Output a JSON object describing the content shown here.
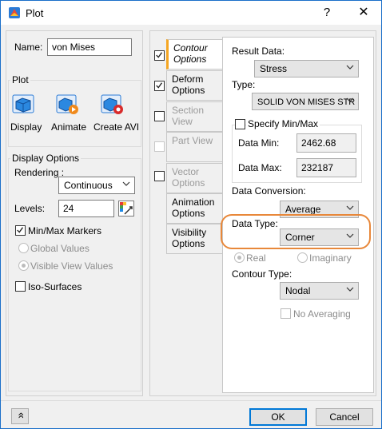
{
  "window": {
    "title": "Plot",
    "help_glyph": "?",
    "close_glyph": "✕"
  },
  "left": {
    "name_label": "Name:",
    "name_value": "von Mises",
    "plot_group": "Plot",
    "plot_buttons": [
      {
        "label": "Display",
        "icon": "display-icon"
      },
      {
        "label": "Animate",
        "icon": "animate-icon"
      },
      {
        "label": "Create AVI",
        "icon": "create-avi-icon"
      }
    ],
    "display_options": {
      "group": "Display Options",
      "rendering_label": "Rendering :",
      "rendering_value": "Continuous",
      "levels_label": "Levels:",
      "levels_value": "24",
      "minmax_label": "Min/Max Markers",
      "global_values": "Global Values",
      "visible_values": "Visible View Values",
      "iso_surfaces": "Iso-Surfaces"
    }
  },
  "tabs": [
    {
      "label_1": "Contour",
      "label_2": "Options",
      "checked": true
    },
    {
      "label_1": "Deform",
      "label_2": "Options",
      "checked": true
    },
    {
      "label_1": "Section View",
      "label_2": "",
      "checked": false
    },
    {
      "label_1": "Part View",
      "label_2": "",
      "checked": false
    },
    {
      "label_1": "Vector",
      "label_2": "Options",
      "checked": false
    },
    {
      "label_1": "Animation",
      "label_2": "Options"
    },
    {
      "label_1": "Visibility",
      "label_2": "Options"
    }
  ],
  "right": {
    "result_data_label": "Result Data:",
    "result_data_value": "Stress",
    "type_label": "Type:",
    "type_value": "SOLID VON MISES STR",
    "specify_minmax_label": "Specify Min/Max",
    "data_min_label": "Data Min:",
    "data_min_value": "2462.68",
    "data_max_label": "Data Max:",
    "data_max_value": "232187",
    "data_conversion_label": "Data Conversion:",
    "data_conversion_value": "Average",
    "data_type_label": "Data Type:",
    "data_type_value": "Corner",
    "real_label": "Real",
    "imaginary_label": "Imaginary",
    "contour_type_label": "Contour Type:",
    "contour_type_value": "Nodal",
    "no_averaging_label": "No Averaging"
  },
  "footer": {
    "expand_glyph": "»",
    "ok_label": "OK",
    "cancel_label": "Cancel"
  },
  "colors": {
    "highlight": "#e8883a",
    "active_tab_accent": "#f5a623",
    "default_button": "#0078d7"
  }
}
